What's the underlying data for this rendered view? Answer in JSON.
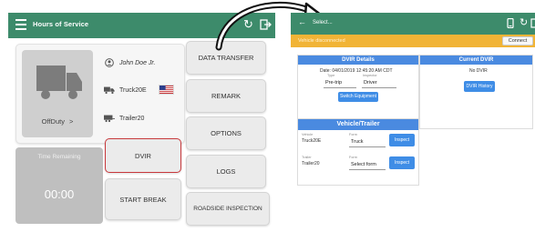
{
  "left_app": {
    "title": "Hours of Service",
    "driver_name": "John Doe Jr.",
    "truck": "Truck20E",
    "trailer": "Trailer20",
    "status": "OffDuty",
    "status_chevron": ">",
    "time_remaining_label": "Time Remaining",
    "time_remaining_value": "00:00",
    "buttons": {
      "data_transfer": "DATA TRANSFER",
      "remark": "REMARK",
      "options": "OPTIONS",
      "logs": "LOGS",
      "roadside_inspection": "ROADSIDE INSPECTION",
      "dvir": "DVIR",
      "start_break": "START BREAK"
    },
    "colors": {
      "toolbar": "#3d8b6b",
      "dvir_highlight": "#c8393c"
    }
  },
  "right_app": {
    "title": "Select...",
    "vehicle_status": "Vehicle disconnected",
    "connect_label": "Connect",
    "dvir_details_header": "DVIR Details",
    "date": "Date: 04/01/2019 12:45:20 AM CDT",
    "type_label": "Type",
    "type_value": "Pre-trip",
    "inspector_label": "Inspector",
    "inspector_value": "Driver",
    "switch_equipment": "Switch Equipment",
    "current_dvir_header": "Current DVIR",
    "no_dvir": "No DVIR",
    "dvir_history": "DVIR History",
    "vehicle_trailer_header": "Vehicle/Trailer",
    "vehicle_label": "Vehicle",
    "vehicle_value": "Truck20E",
    "form_label": "Form",
    "vehicle_form": "Truck",
    "inspect": "Inspect",
    "trailer_label": "Trailer",
    "trailer_value": "Trailer20",
    "trailer_form": "Select form",
    "colors": {
      "toolbar": "#3d8b6b",
      "warning_bar": "#f1b436",
      "section_header": "#4a8ae0"
    }
  }
}
